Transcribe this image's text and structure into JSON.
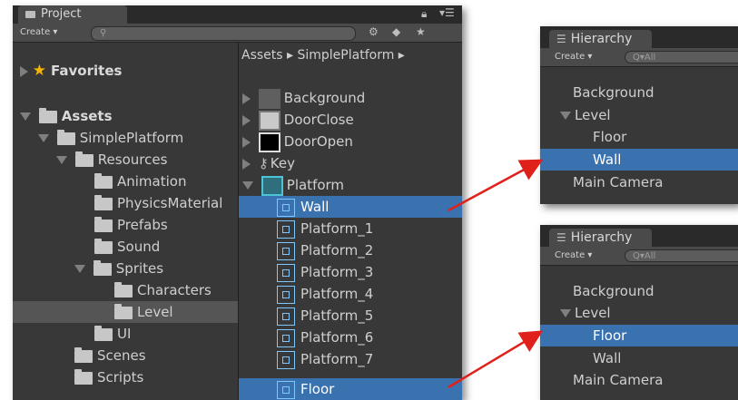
{
  "project": {
    "tab_label": "Project",
    "create_label": "Create ▾",
    "search_placeholder": "",
    "tree": {
      "favorites": "Favorites",
      "assets": "Assets",
      "simple_platform": "SimplePlatform",
      "resources": "Resources",
      "animation": "Animation",
      "physics_material": "PhysicsMaterial",
      "prefabs": "Prefabs",
      "sound": "Sound",
      "sprites": "Sprites",
      "characters": "Characters",
      "level": "Level",
      "ui": "UI",
      "scenes": "Scenes",
      "scripts": "Scripts"
    },
    "breadcrumb": "Assets ▸ SimplePlatform ▸",
    "assets": {
      "background": "Background",
      "door_close": "DoorClose",
      "door_open": "DoorOpen",
      "key": "Key",
      "platform": "Platform",
      "wall": "Wall",
      "platform_1": "Platform_1",
      "platform_2": "Platform_2",
      "platform_3": "Platform_3",
      "platform_4": "Platform_4",
      "platform_5": "Platform_5",
      "platform_6": "Platform_6",
      "platform_7": "Platform_7",
      "floor": "Floor"
    }
  },
  "hierarchy_top": {
    "tab_label": "Hierarchy",
    "create_label": "Create ▾",
    "search_placeholder": "Q▾All",
    "items": {
      "background": "Background",
      "level": "Level",
      "floor": "Floor",
      "wall": "Wall",
      "main_camera": "Main Camera"
    }
  },
  "hierarchy_bottom": {
    "tab_label": "Hierarchy",
    "create_label": "Create ▾",
    "search_placeholder": "Q▾All",
    "items": {
      "background": "Background",
      "level": "Level",
      "floor": "Floor",
      "wall": "Wall",
      "main_camera": "Main Camera"
    }
  },
  "colors": {
    "panel_bg": "#383838",
    "selection_blue": "#3a72b0",
    "arrow_red": "#e0201a",
    "favorites_star": "#f5b400"
  }
}
